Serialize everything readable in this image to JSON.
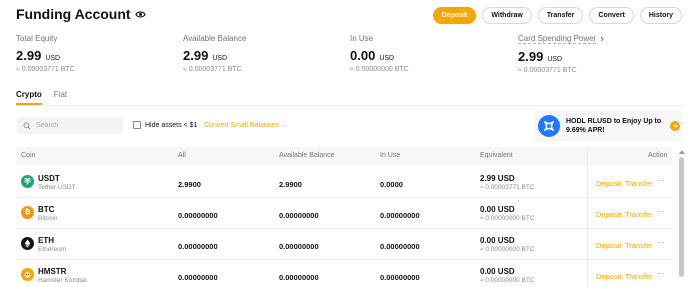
{
  "header": {
    "title": "Funding Account",
    "buttons": {
      "deposit": "Deposit",
      "withdraw": "Withdraw",
      "transfer": "Transfer",
      "convert": "Convert",
      "history": "History"
    }
  },
  "stats": [
    {
      "label": "Total Equity",
      "value": "2.99",
      "unit": "USD",
      "btc": "≈ 0.00003771 BTC"
    },
    {
      "label": "Available Balance",
      "value": "2.99",
      "unit": "USD",
      "btc": "≈ 0.00003771 BTC"
    },
    {
      "label": "In Use",
      "value": "0.00",
      "unit": "USD",
      "btc": "≈ 0.00000000 BTC"
    },
    {
      "label": "Card Spending Power",
      "value": "2.99",
      "unit": "USD",
      "btc": "≈ 0.00003771 BTC"
    }
  ],
  "tabs": {
    "crypto": "Crypto",
    "fiat": "Fiat"
  },
  "toolbar": {
    "search_placeholder": "Search",
    "hide_small_label": "Hide assets < $1",
    "convert_small_label": "Convert Small Balances →"
  },
  "promo": {
    "text": "HODL RLUSD to Enjoy Up to 9.69% APR!"
  },
  "table": {
    "headers": {
      "coin": "Coin",
      "all": "All",
      "available": "Available Balance",
      "in_use": "In Use",
      "equivalent": "Equivalent",
      "action": "Action"
    },
    "actions": {
      "deposit": "Deposit",
      "transfer": "Transfer",
      "more": "···"
    },
    "rows": [
      {
        "symbol": "USDT",
        "name": "Tether USDT",
        "all": "2.9900",
        "available": "2.9900",
        "in_use": "0.0000",
        "eq_usd": "2.99 USD",
        "eq_btc": "≈ 0.00003771 BTC"
      },
      {
        "symbol": "BTC",
        "name": "Bitcoin",
        "all": "0.00000000",
        "available": "0.00000000",
        "in_use": "0.00000000",
        "eq_usd": "0.00 USD",
        "eq_btc": "≈ 0.00000000 BTC"
      },
      {
        "symbol": "ETH",
        "name": "Ethereum",
        "all": "0.00000000",
        "available": "0.00000000",
        "in_use": "0.00000000",
        "eq_usd": "0.00 USD",
        "eq_btc": "≈ 0.00000000 BTC"
      },
      {
        "symbol": "HMSTR",
        "name": "Hamster Kombat",
        "all": "0.00000000",
        "available": "0.00000000",
        "in_use": "0.00000000",
        "eq_usd": "0.00 USD",
        "eq_btc": "≈ 0.00000000 BTC"
      }
    ]
  },
  "colors": {
    "accent": "#f7a600",
    "usdt": "#26a17b",
    "btc": "#f7931a",
    "eth": "#121214",
    "hmstr": "#f7a600",
    "rlusd": "#1f78ff"
  }
}
